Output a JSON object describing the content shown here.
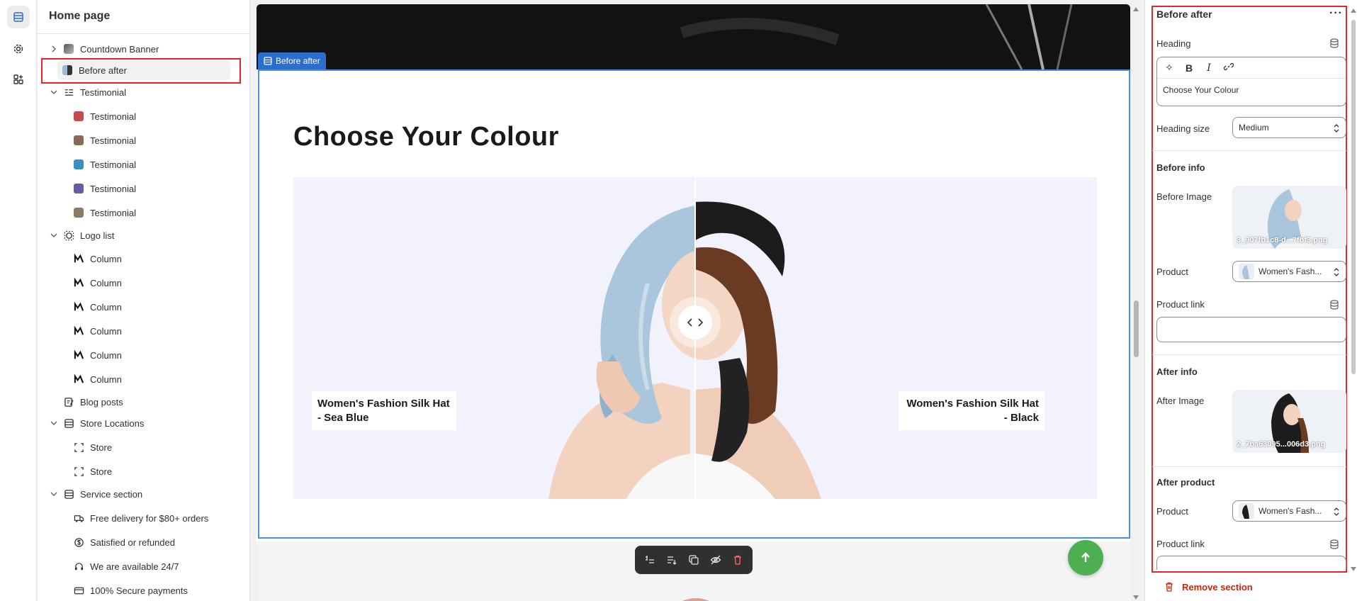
{
  "rail": {
    "items": [
      {
        "name": "sections-icon",
        "active": true
      },
      {
        "name": "gear-icon",
        "active": false
      },
      {
        "name": "apps-icon",
        "active": false
      }
    ]
  },
  "tree": {
    "title": "Home page",
    "items": [
      {
        "label": "Countdown Banner",
        "depth": 0,
        "chevron": "right",
        "icon": "banner-thumb"
      },
      {
        "label": "Before after",
        "depth": 0,
        "chevron": "",
        "icon": "before-after-thumb",
        "selected": true
      },
      {
        "label": "Testimonial",
        "depth": 0,
        "chevron": "down",
        "icon": "testimonial-section-icon"
      },
      {
        "label": "Testimonial",
        "depth": 1,
        "icon": "testimonial-thumb",
        "thumbColor": "#c94a4a"
      },
      {
        "label": "Testimonial",
        "depth": 1,
        "icon": "testimonial-thumb",
        "thumbColor": "#8a6a56"
      },
      {
        "label": "Testimonial",
        "depth": 1,
        "icon": "testimonial-thumb",
        "thumbColor": "#3a8fc2"
      },
      {
        "label": "Testimonial",
        "depth": 1,
        "icon": "testimonial-thumb",
        "thumbColor": "#6a5aa6"
      },
      {
        "label": "Testimonial",
        "depth": 1,
        "icon": "testimonial-thumb",
        "thumbColor": "#8a7a66"
      },
      {
        "label": "Logo list",
        "depth": 0,
        "chevron": "down",
        "icon": "logo-list-icon"
      },
      {
        "label": "Column",
        "depth": 1,
        "icon": "column-logo-icon"
      },
      {
        "label": "Column",
        "depth": 1,
        "icon": "column-logo-icon"
      },
      {
        "label": "Column",
        "depth": 1,
        "icon": "column-logo-icon"
      },
      {
        "label": "Column",
        "depth": 1,
        "icon": "column-logo-icon"
      },
      {
        "label": "Column",
        "depth": 1,
        "icon": "column-logo-icon"
      },
      {
        "label": "Column",
        "depth": 1,
        "icon": "column-logo-icon"
      },
      {
        "label": "Blog posts",
        "depth": 0,
        "chevron": "",
        "icon": "blog-icon"
      },
      {
        "label": "Store Locations",
        "depth": 0,
        "chevron": "down",
        "icon": "section-icon"
      },
      {
        "label": "Store",
        "depth": 1,
        "icon": "block-icon"
      },
      {
        "label": "Store",
        "depth": 1,
        "icon": "block-icon"
      },
      {
        "label": "Service section",
        "depth": 0,
        "chevron": "down",
        "icon": "section-icon"
      },
      {
        "label": "Free delivery for $80+ orders",
        "depth": 1,
        "icon": "truck-icon"
      },
      {
        "label": "Satisfied or refunded",
        "depth": 1,
        "icon": "dollar-icon"
      },
      {
        "label": "We are available 24/7",
        "depth": 1,
        "icon": "support-icon"
      },
      {
        "label": "100% Secure payments",
        "depth": 1,
        "icon": "card-icon"
      }
    ]
  },
  "canvas": {
    "section_tag": "Before after",
    "heading": "Choose Your Colour",
    "before_label": "Women's Fashion Silk Hat - Sea Blue",
    "after_label": "Women's Fashion Silk Hat - Black",
    "toolbar": [
      "move-up-icon",
      "move-down-icon",
      "duplicate-icon",
      "hide-icon",
      "delete-icon"
    ]
  },
  "settings": {
    "title": "Before after",
    "heading_label": "Heading",
    "heading_value": "Choose Your Colour",
    "heading_size_label": "Heading size",
    "heading_size_value": "Medium",
    "before_info": "Before info",
    "before_image_label": "Before Image",
    "before_image_file": "3_907fb1c8-d...7fbf3.png",
    "product_label": "Product",
    "before_product": "Women's Fash...",
    "product_link_label": "Product link",
    "after_info": "After info",
    "after_image_label": "After Image",
    "after_image_file": "2_7ba63095...006d3.png",
    "after_product_heading": "After product",
    "after_product": "Women's Fash...",
    "remove_section": "Remove section"
  },
  "colors": {
    "accent_blue": "#2c6ecb",
    "highlight_red": "#e0262f",
    "fab_green": "#4caf50",
    "danger": "#c5280c"
  }
}
